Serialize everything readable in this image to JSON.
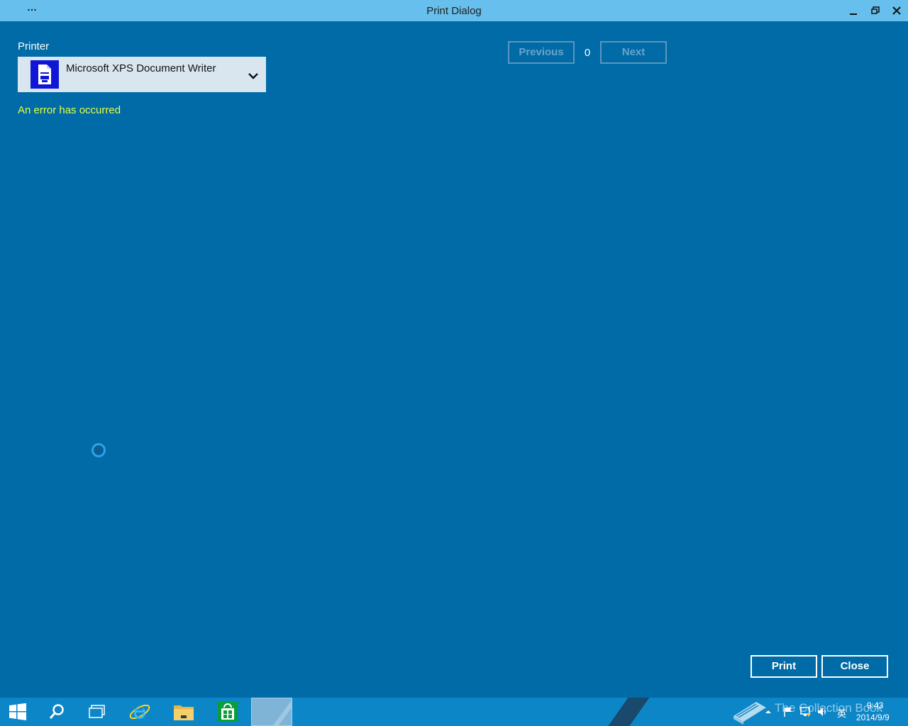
{
  "window": {
    "title": "Print Dialog",
    "menu_glyph": "…",
    "controls": [
      "minimize-icon",
      "restore-icon",
      "close-icon"
    ]
  },
  "printer": {
    "label": "Printer",
    "selected": "Microsoft XPS Document Writer",
    "icon": "printer-document-icon",
    "error": "An error has occurred"
  },
  "navigation": {
    "previous_label": "Previous",
    "page_number": "0",
    "next_label": "Next"
  },
  "actions": {
    "print_label": "Print",
    "close_label": "Close"
  },
  "taskbar": {
    "items": [
      "start-icon",
      "search-icon",
      "task-view-icon",
      "internet-explorer-icon",
      "file-explorer-icon",
      "store-icon",
      "print-dialog-app"
    ],
    "watermark": "The Collection Book",
    "ime_label": "英",
    "clock_time": "9:43",
    "clock_date": "2014/9/9"
  },
  "colors": {
    "background": "#006ba6",
    "titlebar": "#66bfec",
    "error_text": "#e6ff3f",
    "taskbar": "#0d86c7",
    "printer_icon_bg": "#0f16d6"
  }
}
